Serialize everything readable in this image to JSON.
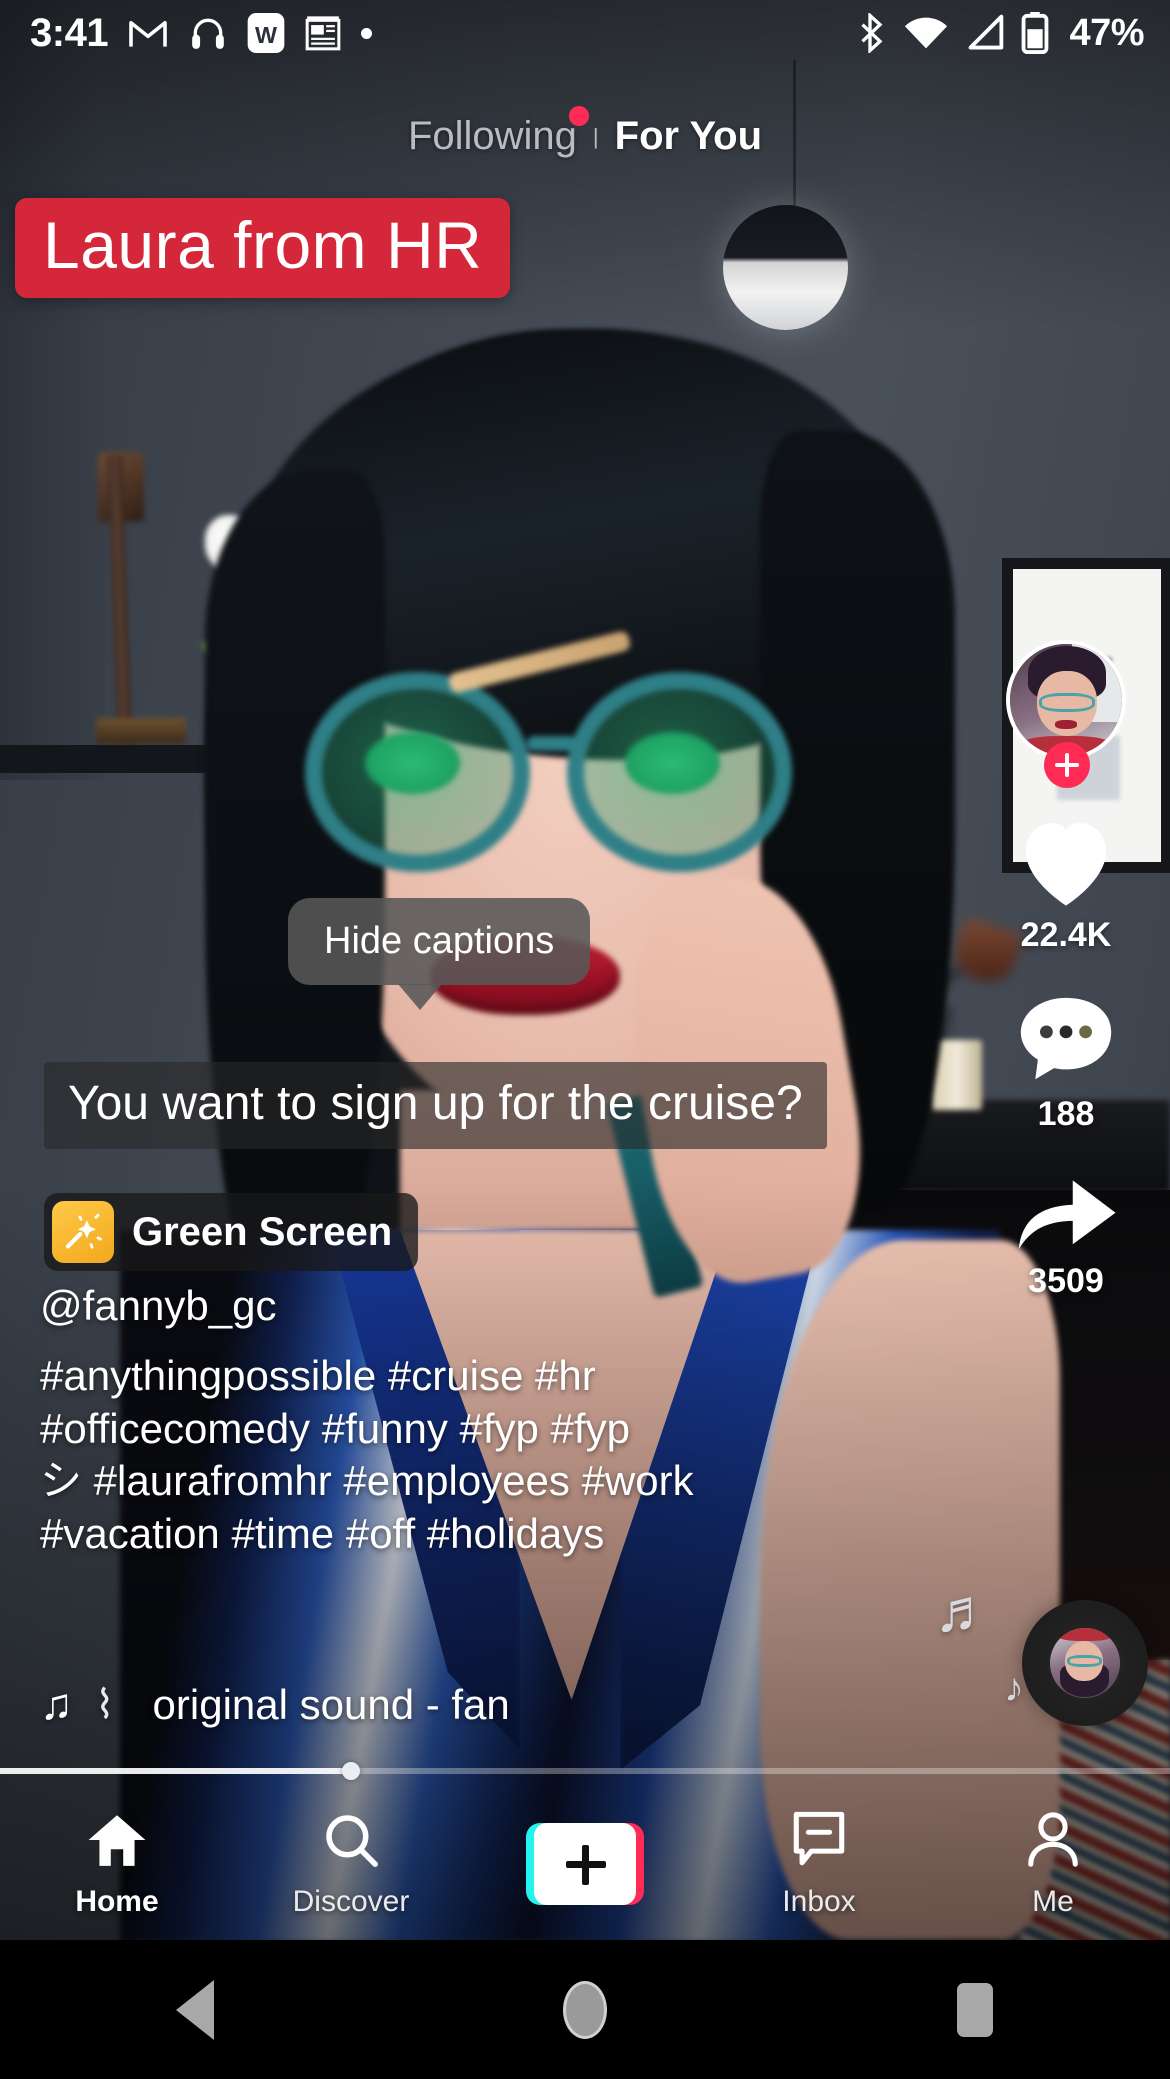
{
  "status_bar": {
    "time": "3:41",
    "battery_percent": "47%",
    "left_icons": [
      "gmail-icon",
      "headphones-icon",
      "word-icon",
      "news-icon",
      "dot-icon"
    ],
    "right_icons": [
      "bluetooth-icon",
      "wifi-icon",
      "cellular-signal-icon",
      "battery-icon"
    ]
  },
  "top_tabs": {
    "following_label": "Following",
    "foryou_label": "For You",
    "separator": "|",
    "active": "For You",
    "badge_color": "#fe2c55"
  },
  "video": {
    "name_banner": "Laura from HR",
    "name_banner_color": "#d5273a",
    "caption_tooltip": "Hide captions",
    "caption_text": "You want to sign up for the cruise?",
    "effect_badge": {
      "label": "Green Screen",
      "icon": "magic-wand-icon",
      "icon_color": "#ffc947"
    },
    "author_handle": "@fannyb_gc",
    "description_lines": [
      "#anythingpossible #cruise #hr",
      "#officecomedy #funny #fyp #fyp",
      "シ #laurafromhr #employees #work",
      "#vacation #time #off #holidays"
    ],
    "music": {
      "note_glyph": "♫",
      "wave_glyph": "⌇",
      "title": "original sound - fan"
    },
    "progress_percent": 30
  },
  "action_rail": {
    "avatar_name": "author-avatar",
    "follow_icon": "plus-icon",
    "like": {
      "icon": "heart-icon",
      "count": "22.4K"
    },
    "comment": {
      "icon": "comment-bubble-icon",
      "count": "188"
    },
    "share": {
      "icon": "share-arrow-icon",
      "count": "3509"
    },
    "disc": {
      "icon": "music-disc-icon"
    },
    "floating_notes": [
      "♬",
      "♪"
    ]
  },
  "bottom_nav": {
    "items": [
      {
        "label": "Home",
        "icon": "home-icon",
        "active": true
      },
      {
        "label": "Discover",
        "icon": "search-icon",
        "active": false
      },
      {
        "label": "",
        "icon": "create-plus-icon",
        "active": false
      },
      {
        "label": "Inbox",
        "icon": "inbox-icon",
        "active": false
      },
      {
        "label": "Me",
        "icon": "person-icon",
        "active": false
      }
    ],
    "create_colors": {
      "cyan": "#25f4ee",
      "pink": "#fe2c55"
    }
  },
  "android_nav": {
    "back": "back-triangle-icon",
    "home": "home-circle-icon",
    "recents": "recents-square-icon"
  }
}
